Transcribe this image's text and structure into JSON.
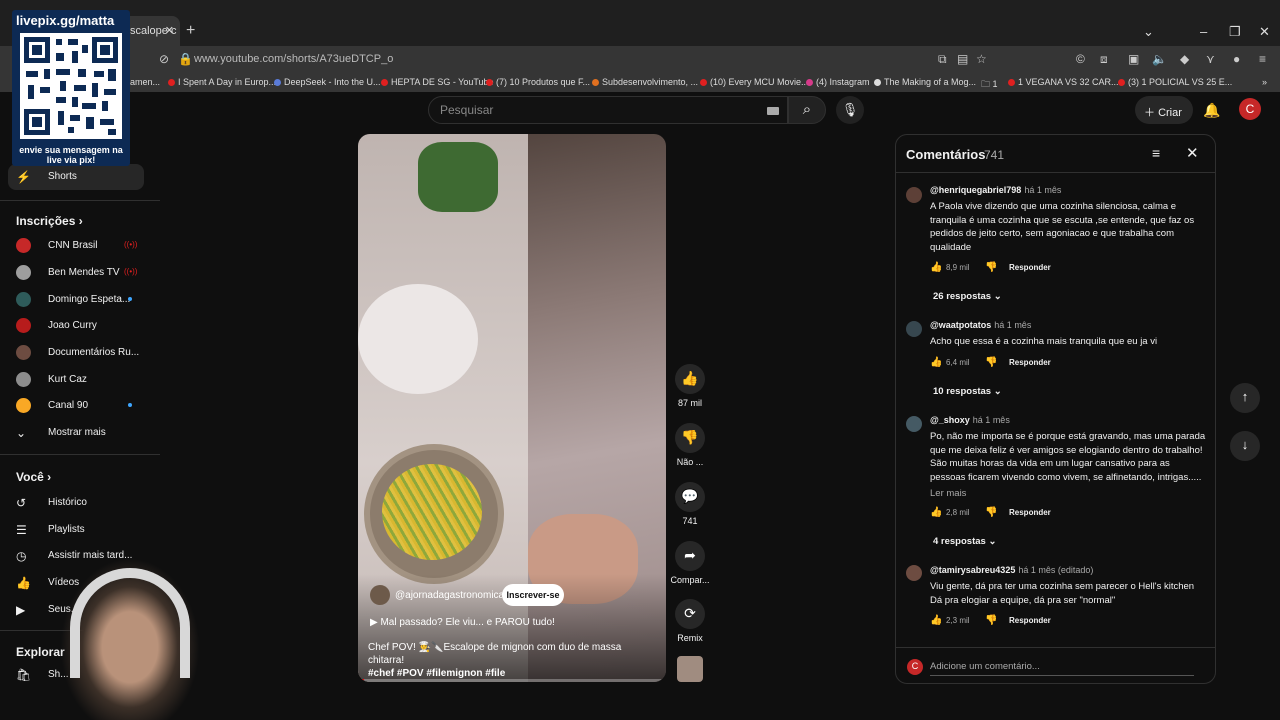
{
  "browser": {
    "tab_title": "scalope c",
    "url": "www.youtube.com/shorts/A73ueDTCP_o",
    "bookmarks": [
      "amen...",
      "I Spent A Day in Europ...",
      "DeepSeek - Into the U...",
      "HEPTA DE SG - YouTube",
      "(7) 10 Produtos que F...",
      "Subdesenvolvimento, ...",
      "(10) Every MCU Movie...",
      "(4) Instagram",
      "The Making of a Mog...",
      "1",
      "1 VEGANA VS 32 CAR...",
      "(3) 1 POLICIAL VS 25 E..."
    ]
  },
  "overlay": {
    "top": "livepix.gg/matta",
    "bottom": "envie sua mensagem na live via pix!"
  },
  "header": {
    "search_placeholder": "Pesquisar",
    "create_label": "Criar",
    "avatar_letter": "C"
  },
  "sidebar": {
    "shorts": "Shorts",
    "subs_heading": "Inscrições",
    "channels": [
      {
        "name": "CNN Brasil",
        "status": "live",
        "color": "#c62828"
      },
      {
        "name": "Ben Mendes TV",
        "status": "live",
        "color": "#9e9e9e"
      },
      {
        "name": "Domingo Espeta...",
        "status": "new",
        "color": "#2e5b5a"
      },
      {
        "name": "Joao Curry",
        "status": "",
        "color": "#b71c1c"
      },
      {
        "name": "Documentários Ru...",
        "status": "",
        "color": "#6d4c41"
      },
      {
        "name": "Kurt Caz",
        "status": "",
        "color": "#8d8d8d"
      },
      {
        "name": "Canal 90",
        "status": "new",
        "color": "#f9a825"
      }
    ],
    "show_more": "Mostrar mais",
    "you_heading": "Você",
    "you_items": [
      "Histórico",
      "Playlists",
      "Assistir mais tard...",
      "Vídeos",
      "Seus..."
    ],
    "explore_heading": "Explorar",
    "explore_items": [
      "Sh..."
    ]
  },
  "video": {
    "channel": "@ajornadagastronomica",
    "subscribe": "Inscrever-se",
    "title": "Mal passado? Ele viu... e PAROU tudo!",
    "description": "Chef POV! 👨‍🍳🔪Escalope de mignon com duo de massa chitarra!",
    "hashtags": "#chef #POV #filemignon #file",
    "progress": 0.02
  },
  "actions": {
    "likes": "87 mil",
    "dislike": "Não ...",
    "comments": "741",
    "share": "Compar...",
    "remix": "Remix"
  },
  "comments": {
    "title": "Comentários",
    "count": "741",
    "items": [
      {
        "author": "@henriquegabriel798",
        "date": "há 1 mês",
        "text": "A Paola vive dizendo que uma cozinha silenciosa, calma e tranquila é uma cozinha que se escuta ,se entende, que faz os pedidos de jeito certo, sem agoniacao e que trabalha com qualidade",
        "likes": "8,9 mil",
        "replies": "26 respostas",
        "more": ""
      },
      {
        "author": "@waatpotatos",
        "date": "há 1 mês",
        "text": "Acho que essa é a cozinha mais tranquila que eu ja vi",
        "likes": "6,4 mil",
        "replies": "10 respostas",
        "more": ""
      },
      {
        "author": "@_shoxy",
        "date": "há 1 mês",
        "text": "Po, não me importa se é porque está gravando, mas uma parada que me deixa feliz é ver amigos se elogiando dentro do trabalho! São muitas horas da vida em um lugar cansativo para as pessoas ficarem vivendo como vivem, se alfinetando, intrigas.....",
        "likes": "2,8 mil",
        "replies": "4 respostas",
        "more": "Ler mais"
      },
      {
        "author": "@tamirysabreu4325",
        "date": "há 1 mês (editado)",
        "text": "Viu gente, dá pra ter uma cozinha sem parecer o Hell's kitchen Dá pra elogiar a equipe, dá pra ser \"normal\"",
        "likes": "2,3 mil",
        "replies": "",
        "more": ""
      }
    ],
    "reply_label": "Responder",
    "add_placeholder": "Adicione um comentário...",
    "footer_avatar": "C"
  },
  "colors": {
    "accent_red": "#ff0000",
    "bg": "#0f0f0f"
  }
}
